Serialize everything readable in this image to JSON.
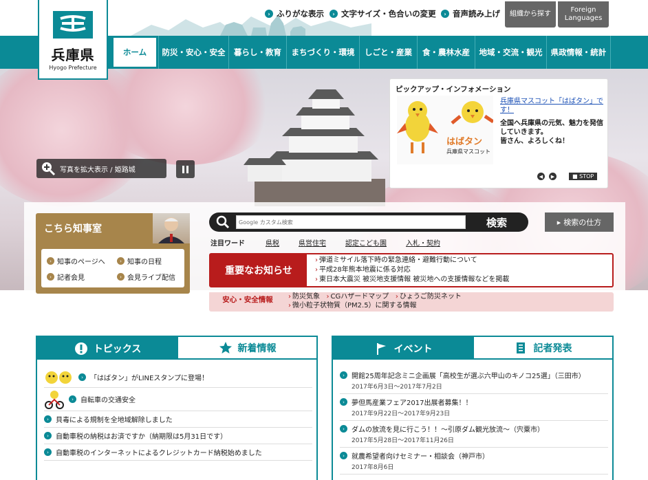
{
  "header": {
    "logo_name": "兵庫県",
    "logo_en": "Hyogo Prefecture",
    "utility": [
      "ふりがな表示",
      "文字サイズ・色合いの変更",
      "音声読み上げ"
    ],
    "org_search": "組織から探す",
    "foreign": "Foreign Languages"
  },
  "nav": {
    "items": [
      "ホーム",
      "防災・安心・安全",
      "暮らし・教育",
      "まちづくり・環境",
      "しごと・産業",
      "食・農林水産",
      "地域・交流・観光",
      "県政情報・統計"
    ]
  },
  "hero": {
    "zoom_label": "写真を拡大表示 / 姫路城",
    "pickup_title": "ピックアップ・インフォメーション",
    "pickup_link": "兵庫県マスコット「はばタン」です！",
    "pickup_text": "全国へ兵庫県の元気、魅力を発信していきます。\n皆さん、よろしくね！",
    "mascot_logo": "はばタン",
    "mascot_caption": "兵庫県マスコット",
    "stop_label": "STOP"
  },
  "governor": {
    "title": "こちら知事室",
    "links": [
      "知事のページへ",
      "知事の日程",
      "記者会見",
      "会見ライブ配信"
    ]
  },
  "search": {
    "placeholder": "カスタム検索",
    "google": "Google",
    "button": "検索",
    "howto": "検索の仕方",
    "hot_label": "注目ワード",
    "hot_words": [
      "県税",
      "県営住宅",
      "認定こども園",
      "入札・契約"
    ]
  },
  "important": {
    "title": "重要なお知らせ",
    "items": [
      "弾道ミサイル落下時の緊急連絡・避難行動について",
      "平成28年熊本地震に係る対応",
      "東日本大震災 被災地支援情報 被災地への支援情報などを掲載"
    ]
  },
  "safety": {
    "title": "安心・安全情報",
    "items": [
      "防災気象",
      "CGハザードマップ",
      "ひょうご防災ネット",
      "微小粒子状物質（PM2.5）に関する情報"
    ]
  },
  "topics": {
    "tab_on": "トピックス",
    "tab_off": "新着情報",
    "items": [
      "「はばタン」がLINEスタンプに登場！",
      "自転車の交通安全",
      "貝毒による規制を全地域解除しました",
      "自動車税の納税はお済ですか（納期限は5月31日です）",
      "自動車税のインターネットによるクレジットカード納税始めました"
    ]
  },
  "events": {
    "tab_on": "イベント",
    "tab_off": "記者発表",
    "items": [
      {
        "title": "開館25周年記念ミニ企画展「高校生が選ぶ六甲山のキノコ25選」（三田市）",
        "date": "2017年6月3日～2017年7月2日"
      },
      {
        "title": "夢但馬産業フェア2017出展者募集！！",
        "date": "2017年9月22日～2017年9月23日"
      },
      {
        "title": "ダムの放流を見に行こう！！～引原ダム観光放流～（宍粟市）",
        "date": "2017年5月28日～2017年11月26日"
      },
      {
        "title": "就農希望者向けセミナー・相談会（神戸市）",
        "date": "2017年8月6日"
      }
    ]
  }
}
